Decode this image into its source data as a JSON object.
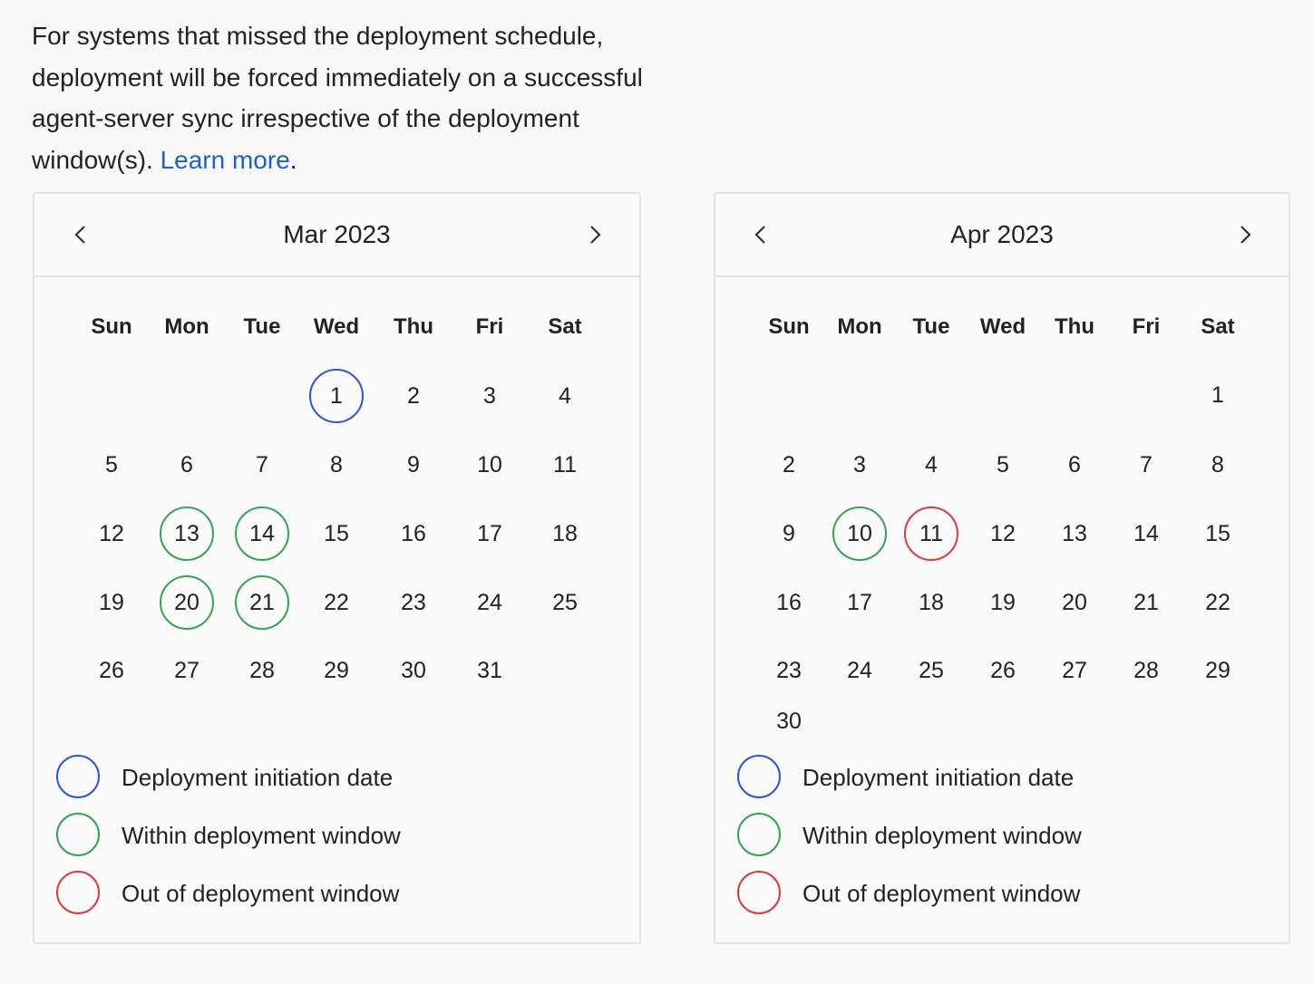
{
  "intro": {
    "text": "For systems that missed the deployment schedule, deployment will be forced immediately on a successful agent-server sync irrespective of the deployment window(s). ",
    "link": "Learn more",
    "suffix": "."
  },
  "colors": {
    "initiation": "#2c55d8",
    "within": "#35a354",
    "out": "#d93c3c",
    "link": "#1f5fd6"
  },
  "weekdays": [
    "Sun",
    "Mon",
    "Tue",
    "Wed",
    "Thu",
    "Fri",
    "Sat"
  ],
  "legend": [
    {
      "key": "initiation",
      "label": "Deployment initiation date"
    },
    {
      "key": "within",
      "label": "Within deployment window"
    },
    {
      "key": "out",
      "label": "Out of deployment window"
    }
  ],
  "calendars": [
    {
      "title": "Mar 2023",
      "first_weekday": 3,
      "days_in_month": 31,
      "marked": {
        "1": "initiation",
        "13": "within",
        "14": "within",
        "20": "within",
        "21": "within"
      }
    },
    {
      "title": "Apr 2023",
      "first_weekday": 6,
      "days_in_month": 30,
      "marked": {
        "10": "within",
        "11": "out"
      }
    }
  ],
  "icons": {
    "prev": "chevron-left-icon",
    "next": "chevron-right-icon"
  }
}
